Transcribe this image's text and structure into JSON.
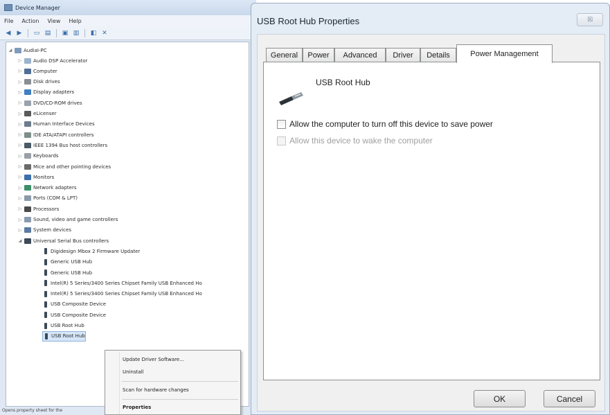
{
  "device_manager": {
    "title": "Device Manager",
    "menu": [
      "File",
      "Action",
      "View",
      "Help"
    ],
    "tree": {
      "root": "AudiaI-PC",
      "categories": [
        "Audio DSP Accelerator",
        "Computer",
        "Disk drives",
        "Display adapters",
        "DVD/CD-ROM drives",
        "eLicenser",
        "Human Interface Devices",
        "IDE ATA/ATAPI controllers",
        "IEEE 1394 Bus host controllers",
        "Keyboards",
        "Mice and other pointing devices",
        "Monitors",
        "Network adapters",
        "Ports (COM & LPT)",
        "Processors",
        "Sound, video and game controllers",
        "System devices",
        "Universal Serial Bus controllers"
      ],
      "usb_children": [
        "Digidesign Mbox 2 Firmware Updater",
        "Generic USB Hub",
        "Generic USB Hub",
        "Intel(R) 5 Series/3400 Series Chipset Family USB Enhanced Ho",
        "Intel(R) 5 Series/3400 Series Chipset Family USB Enhanced Ho",
        "USB Composite Device",
        "USB Composite Device",
        "USB Root Hub",
        "USB Root Hub"
      ]
    },
    "context_menu": {
      "update": "Update Driver Software...",
      "uninstall": "Uninstall",
      "scan": "Scan for hardware changes",
      "properties": "Properties"
    },
    "status": "Opens property sheet for the"
  },
  "dialog": {
    "title": "USB Root Hub Properties",
    "close_glyph": "☒",
    "tabs": [
      "General",
      "Power",
      "Advanced",
      "Driver",
      "Details",
      "Power Management"
    ],
    "active_tab": "Power Management",
    "device_name": "USB Root Hub",
    "checkbox_turn_off": "Allow the computer to turn off this device to save power",
    "checkbox_wake": "Allow this device to wake the computer",
    "ok": "OK",
    "cancel": "Cancel"
  }
}
